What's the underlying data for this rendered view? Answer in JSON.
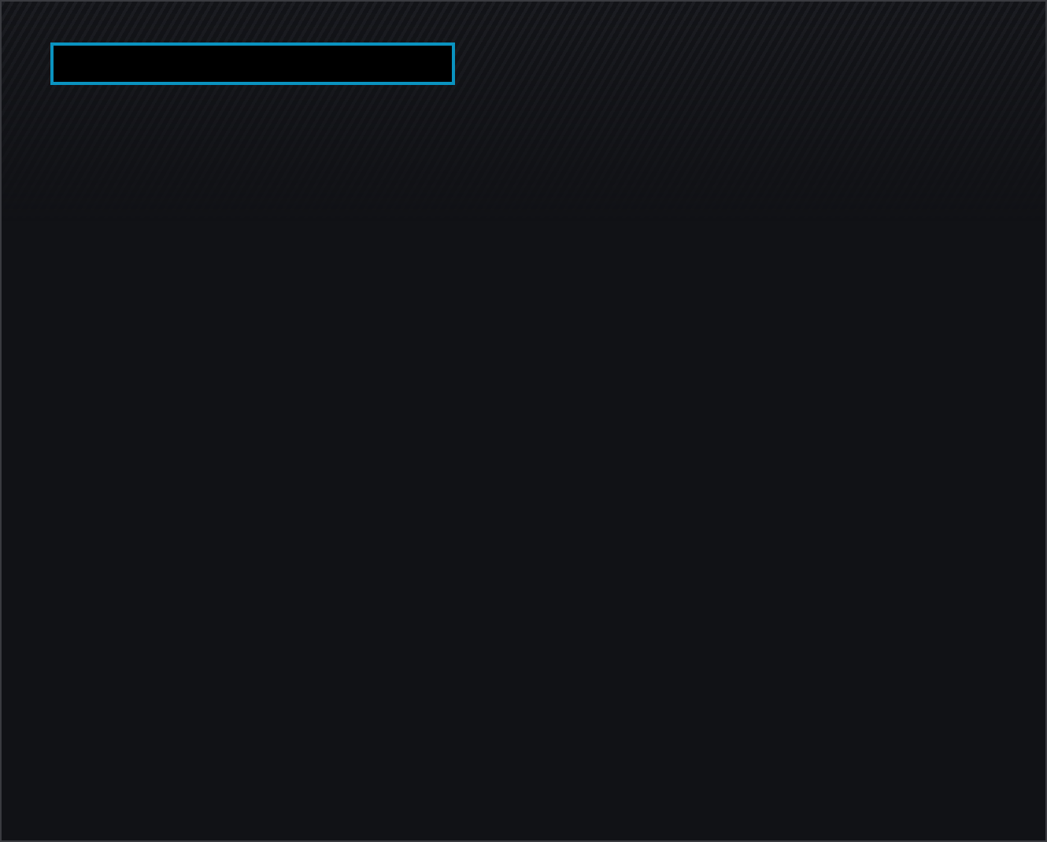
{
  "input_field": {
    "focused": true
  }
}
